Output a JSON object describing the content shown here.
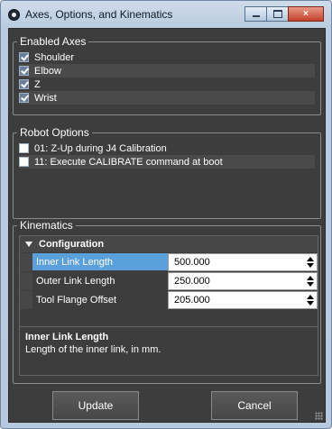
{
  "window": {
    "title": "Axes, Options, and Kinematics",
    "close_glyph": "×"
  },
  "enabled_axes": {
    "legend": "Enabled Axes",
    "items": [
      {
        "label": "Shoulder",
        "checked": true
      },
      {
        "label": "Elbow",
        "checked": true
      },
      {
        "label": "Z",
        "checked": true
      },
      {
        "label": "Wrist",
        "checked": true
      }
    ]
  },
  "robot_options": {
    "legend": "Robot Options",
    "items": [
      {
        "label": "01: Z-Up during J4 Calibration",
        "checked": false
      },
      {
        "label": "11: Execute CALIBRATE command at boot",
        "checked": false
      }
    ]
  },
  "kinematics": {
    "legend": "Kinematics",
    "category": "Configuration",
    "properties": [
      {
        "name": "Inner Link Length",
        "value": "500.000",
        "selected": true
      },
      {
        "name": "Outer Link Length",
        "value": "250.000",
        "selected": false
      },
      {
        "name": "Tool Flange Offset",
        "value": "205.000",
        "selected": false
      }
    ],
    "description": {
      "title": "Inner Link Length",
      "text": "Length of the inner link, in mm."
    }
  },
  "buttons": {
    "update": "Update",
    "cancel": "Cancel"
  },
  "icons": [
    "app-icon",
    "minimize-icon",
    "maximize-icon",
    "close-icon",
    "collapse-triangle-icon",
    "spin-icon",
    "resize-grip-icon"
  ],
  "colors": {
    "selection": "#5aa1dc",
    "panel": "#3d3d3d",
    "close": "#c4402a"
  }
}
